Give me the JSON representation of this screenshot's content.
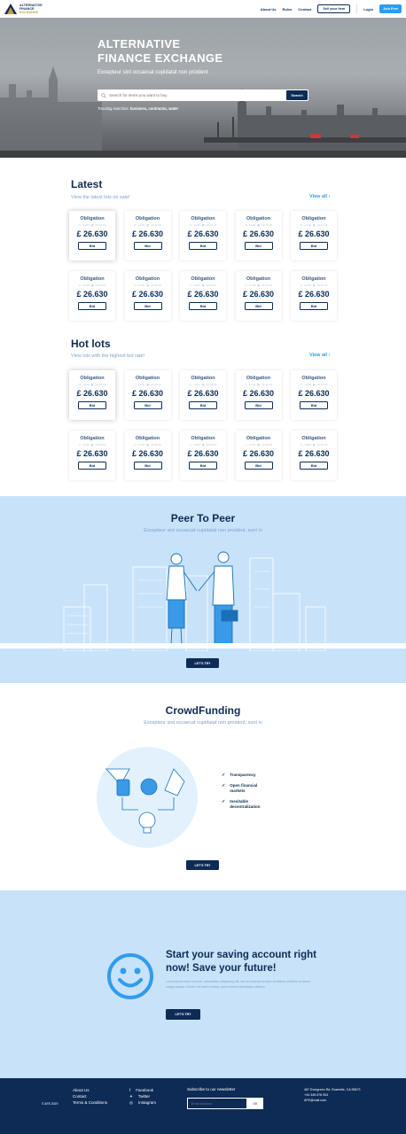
{
  "header": {
    "logo_lines": [
      "ALTERNATIVE",
      "FINANCE",
      "EXCHANGE"
    ],
    "nav": [
      "About Us",
      "Rules",
      "Contact"
    ],
    "sell_label": "Sell your Item",
    "login_label": "Login",
    "join_label": "Join Free"
  },
  "hero": {
    "title_line1": "ALTERNATIVE",
    "title_line2": "FINANCE EXCHANGE",
    "subtitle": "Excepteur sint occaecat cupidatat non proident",
    "search_placeholder": "Search for items you want to buy",
    "search_button": "Search",
    "trending_label": "Trending searches:",
    "trending_terms": "business, contractor, water"
  },
  "latest": {
    "title": "Latest",
    "subtitle": "View the latest lots on sale!",
    "view_all": "View all",
    "cards": [
      {
        "title": "Obligation",
        "time": "14:00",
        "date": "23.10.19",
        "price": "£ 26.630",
        "bid": "Bid"
      },
      {
        "title": "Obligation",
        "time": "14:00",
        "date": "23.10.19",
        "price": "£ 26.630",
        "bid": "Bid"
      },
      {
        "title": "Obligation",
        "time": "14:00",
        "date": "23.10.19",
        "price": "£ 26.630",
        "bid": "Bid"
      },
      {
        "title": "Obligation",
        "time": "14:00",
        "date": "23.10.19",
        "price": "£ 26.630",
        "bid": "Bid"
      },
      {
        "title": "Obligation",
        "time": "14:00",
        "date": "23.10.19",
        "price": "£ 26.630",
        "bid": "Bid"
      },
      {
        "title": "Obligation",
        "time": "14:00",
        "date": "23.10.19",
        "price": "£ 26.630",
        "bid": "Bid"
      },
      {
        "title": "Obligation",
        "time": "14:00",
        "date": "23.10.19",
        "price": "£ 26.630",
        "bid": "Bid"
      },
      {
        "title": "Obligation",
        "time": "14:00",
        "date": "23.10.19",
        "price": "£ 26.630",
        "bid": "Bid"
      },
      {
        "title": "Obligation",
        "time": "14:00",
        "date": "23.10.19",
        "price": "£ 26.630",
        "bid": "Bid"
      },
      {
        "title": "Obligation",
        "time": "14:00",
        "date": "23.10.19",
        "price": "£ 26.630",
        "bid": "Bid"
      }
    ]
  },
  "hot": {
    "title": "Hot lots",
    "subtitle": "View lots with the highest bid rate!",
    "view_all": "View all",
    "cards": [
      {
        "title": "Obligation",
        "time": "14:00",
        "date": "23.10.19",
        "price": "£ 26.630",
        "bid": "Bid"
      },
      {
        "title": "Obligation",
        "time": "14:00",
        "date": "23.10.19",
        "price": "£ 26.630",
        "bid": "Bid"
      },
      {
        "title": "Obligation",
        "time": "14:00",
        "date": "23.10.19",
        "price": "£ 26.630",
        "bid": "Bid"
      },
      {
        "title": "Obligation",
        "time": "14:00",
        "date": "23.10.19",
        "price": "£ 26.630",
        "bid": "Bid"
      },
      {
        "title": "Obligation",
        "time": "14:00",
        "date": "23.10.19",
        "price": "£ 26.630",
        "bid": "Bid"
      },
      {
        "title": "Obligation",
        "time": "14:00",
        "date": "23.10.19",
        "price": "£ 26.630",
        "bid": "Bid"
      },
      {
        "title": "Obligation",
        "time": "14:00",
        "date": "23.10.19",
        "price": "£ 26.630",
        "bid": "Bid"
      },
      {
        "title": "Obligation",
        "time": "14:00",
        "date": "23.10.19",
        "price": "£ 26.630",
        "bid": "Bid"
      },
      {
        "title": "Obligation",
        "time": "14:00",
        "date": "23.10.19",
        "price": "£ 26.630",
        "bid": "Bid"
      },
      {
        "title": "Obligation",
        "time": "14:00",
        "date": "23.10.19",
        "price": "£ 26.630",
        "bid": "Bid"
      }
    ]
  },
  "p2p": {
    "title": "Peer To Peer",
    "subtitle": "Excepteur sint occaecat cupidatat non proident, sunt in",
    "button": "LET'S TRY"
  },
  "crowdfunding": {
    "title": "CrowdFunding",
    "subtitle": "Excepteur sint occaecat cupidatat non proident, sunt in",
    "features": [
      "Transparency",
      "Open financial markets",
      "Inevitable decentralization"
    ],
    "button": "LET'S TRY"
  },
  "saving": {
    "title": "Start your saving account right now! Save your future!",
    "body": "Lorem ipsum dolor sit amet, consectetur adipisicing elit, sed do eiusmod tempor incididunt ut labore et dolore magna aliqua. Ut enim ad minim veniam, quis nostrud exercitation ullamco.",
    "button": "LET'S TRY"
  },
  "footer": {
    "copyright": "© AFE 2019",
    "links": [
      "About Us",
      "Contact",
      "Terms & Conditions"
    ],
    "social": [
      "Facebook",
      "Twitter",
      "Instagram"
    ],
    "newsletter_label": "Subscribe to our newsletter",
    "email_placeholder": "Email Address",
    "ok_label": "OK",
    "address": "467 Evergreen Rd. Roseville, CA 95673",
    "phone": "+44 345 678 903",
    "email": "AFE@mail.com"
  },
  "colors": {
    "navy": "#0d2b55",
    "accent_blue": "#2e9cf0",
    "light_blue_bg": "#c8e2fa",
    "muted_text": "#7fa3c9",
    "logo_gold": "#c79a3b"
  }
}
